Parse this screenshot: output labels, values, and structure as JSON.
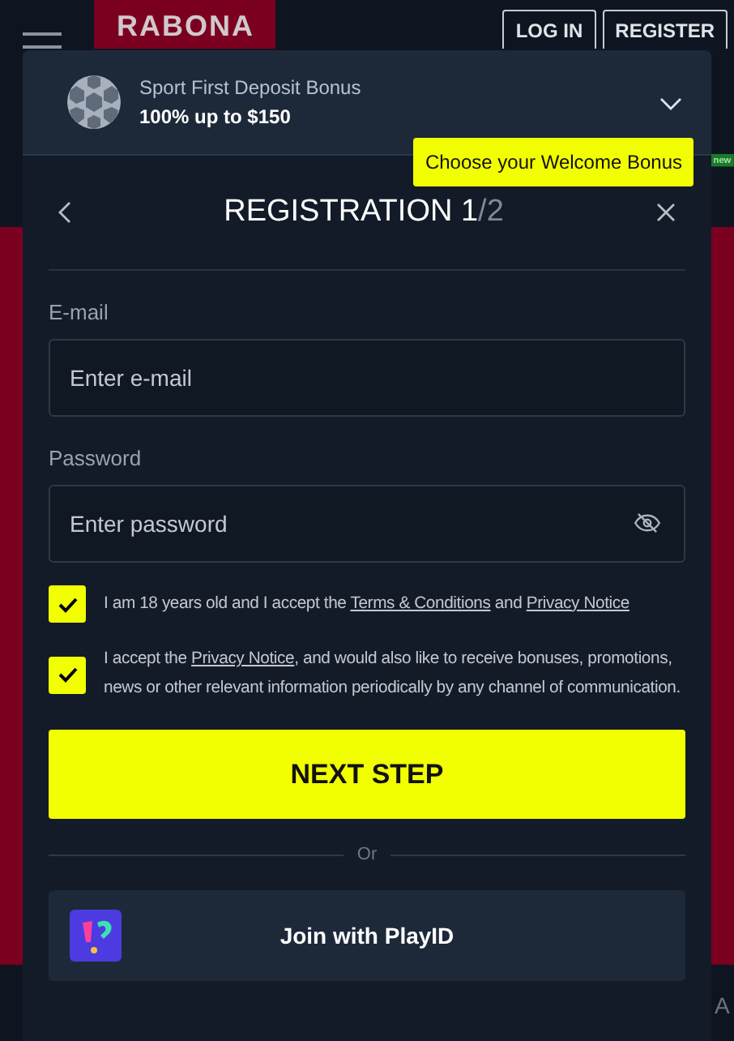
{
  "header": {
    "logo": "RABONA",
    "login": "LOG IN",
    "register": "REGISTER"
  },
  "background": {
    "badge": "new",
    "edge_text": "A"
  },
  "bonus": {
    "title": "Sport First Deposit Bonus",
    "amount": "100% up to $150",
    "tooltip": "Choose your Welcome Bonus"
  },
  "registration": {
    "title": "REGISTRATION",
    "step": "1",
    "total": "/2"
  },
  "fields": [
    {
      "label": "E-mail",
      "placeholder": "Enter e-mail",
      "kind": "email"
    },
    {
      "label": "Password",
      "placeholder": "Enter password",
      "kind": "password"
    }
  ],
  "consents": [
    {
      "checked": true,
      "parts": [
        {
          "kind": "text",
          "text": "I am 18 years old and I accept the "
        },
        {
          "kind": "link",
          "text": "Terms & Conditions"
        },
        {
          "kind": "text",
          "text": " and "
        },
        {
          "kind": "link",
          "text": "Privacy Notice"
        }
      ]
    },
    {
      "checked": true,
      "parts": [
        {
          "kind": "text",
          "text": "I accept the "
        },
        {
          "kind": "link",
          "text": "Privacy Notice"
        },
        {
          "kind": "text",
          "text": ", and would also like to receive bonuses, promotions, news or other relevant information periodically by any channel of communication."
        }
      ]
    }
  ],
  "next_button": "NEXT STEP",
  "divider": "Or",
  "playid_button": "Join with PlayID"
}
